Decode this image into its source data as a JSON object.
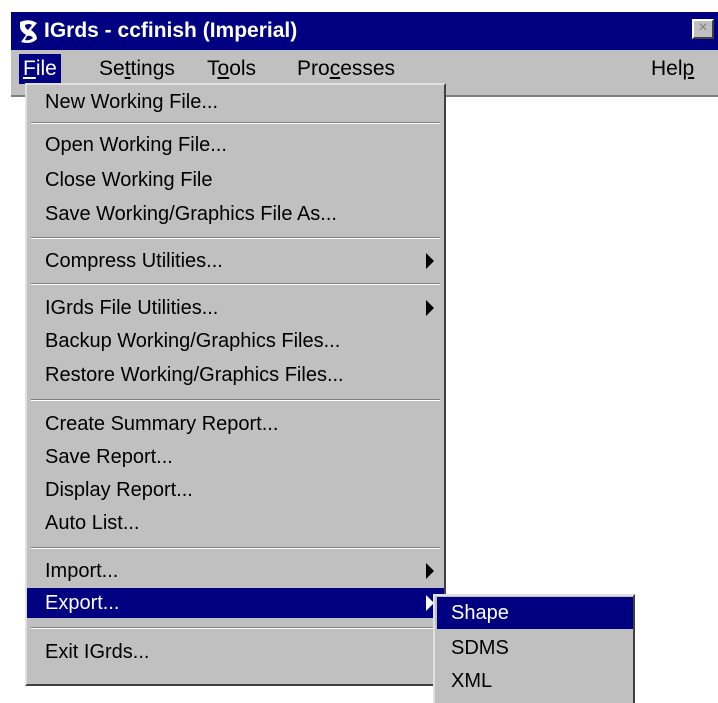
{
  "window": {
    "title": "IGrds - ccfinish (Imperial)",
    "close_glyph": "×"
  },
  "menubar": {
    "file": {
      "pre": "",
      "accel": "F",
      "post": "ile"
    },
    "settings": {
      "pre": "Se",
      "accel": "t",
      "post": "tings"
    },
    "tools": {
      "pre": "T",
      "accel": "o",
      "post": "ols"
    },
    "processes": {
      "pre": "Pro",
      "accel": "c",
      "post": "esses"
    },
    "help": {
      "pre": "Hel",
      "accel": "p",
      "post": ""
    }
  },
  "file_menu": {
    "items": [
      {
        "label": "New Working File..."
      },
      {
        "label": "Open Working File..."
      },
      {
        "label": "Close Working File"
      },
      {
        "label": "Save Working/Graphics File As..."
      },
      {
        "label": "Compress Utilities..."
      },
      {
        "label": "IGrds File Utilities..."
      },
      {
        "label": "Backup Working/Graphics Files..."
      },
      {
        "label": "Restore Working/Graphics Files..."
      },
      {
        "label": "Create Summary Report..."
      },
      {
        "label": "Save Report..."
      },
      {
        "label": "Display Report..."
      },
      {
        "label": "Auto List..."
      },
      {
        "label": "Import..."
      },
      {
        "label": "Export..."
      },
      {
        "label": "Exit IGrds..."
      }
    ]
  },
  "export_submenu": {
    "items": [
      {
        "label": "Shape"
      },
      {
        "label": "SDMS"
      },
      {
        "label": "XML"
      }
    ]
  },
  "colors": {
    "title_bar": "#000080",
    "highlight": "#000080",
    "menu_face": "#c0c0c0"
  }
}
